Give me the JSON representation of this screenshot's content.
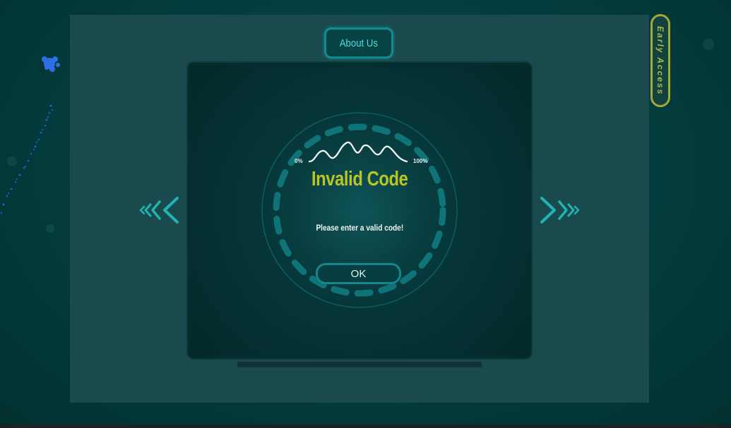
{
  "header": {
    "about_label": "About Us",
    "early_access_label": "Early Access"
  },
  "dialog": {
    "progress_min_label": "0%",
    "progress_max_label": "100%",
    "title": "Invalid Code",
    "message": "Please enter a valid code!",
    "ok_label": "OK"
  },
  "icons": {
    "prev": "double-chevron-left-icon",
    "next": "double-chevron-right-icon",
    "wave": "waveform-icon",
    "ring": "loading-ring-icon"
  },
  "colors": {
    "background": "#023a3c",
    "stage": "#1a4a4d",
    "accent_cyan": "#13878b",
    "title_yellow": "#b9c428",
    "early_access_gold": "#a6a839",
    "arrow_teal": "#1fb3b3"
  }
}
